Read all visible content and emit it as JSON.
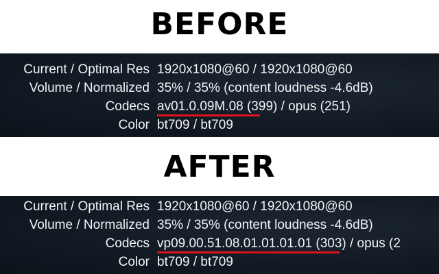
{
  "before": {
    "heading": "BEFORE",
    "rows": [
      {
        "label": "Current / Optimal Res",
        "value": "1920x1080@60 / 1920x1080@60"
      },
      {
        "label": "Volume / Normalized",
        "value": "35% / 35% (content loudness -4.6dB)"
      },
      {
        "label": "Codecs",
        "value": "av01.0.09M.08 (399) / opus (251)"
      },
      {
        "label": "Color",
        "value": "bt709 / bt709"
      }
    ]
  },
  "after": {
    "heading": "AFTER",
    "rows": [
      {
        "label": "Current / Optimal Res",
        "value": "1920x1080@60 / 1920x1080@60"
      },
      {
        "label": "Volume / Normalized",
        "value": "35% / 35% (content loudness -4.6dB)"
      },
      {
        "label": "Codecs",
        "value": "vp09.00.51.08.01.01.01.01 (303) / opus (2"
      },
      {
        "label": "Color",
        "value": "bt709 / bt709"
      }
    ]
  },
  "colors": {
    "panel_bg": "#121a24",
    "text": "#f2f4f6",
    "underline": "#e2121b",
    "heading": "#000000"
  }
}
